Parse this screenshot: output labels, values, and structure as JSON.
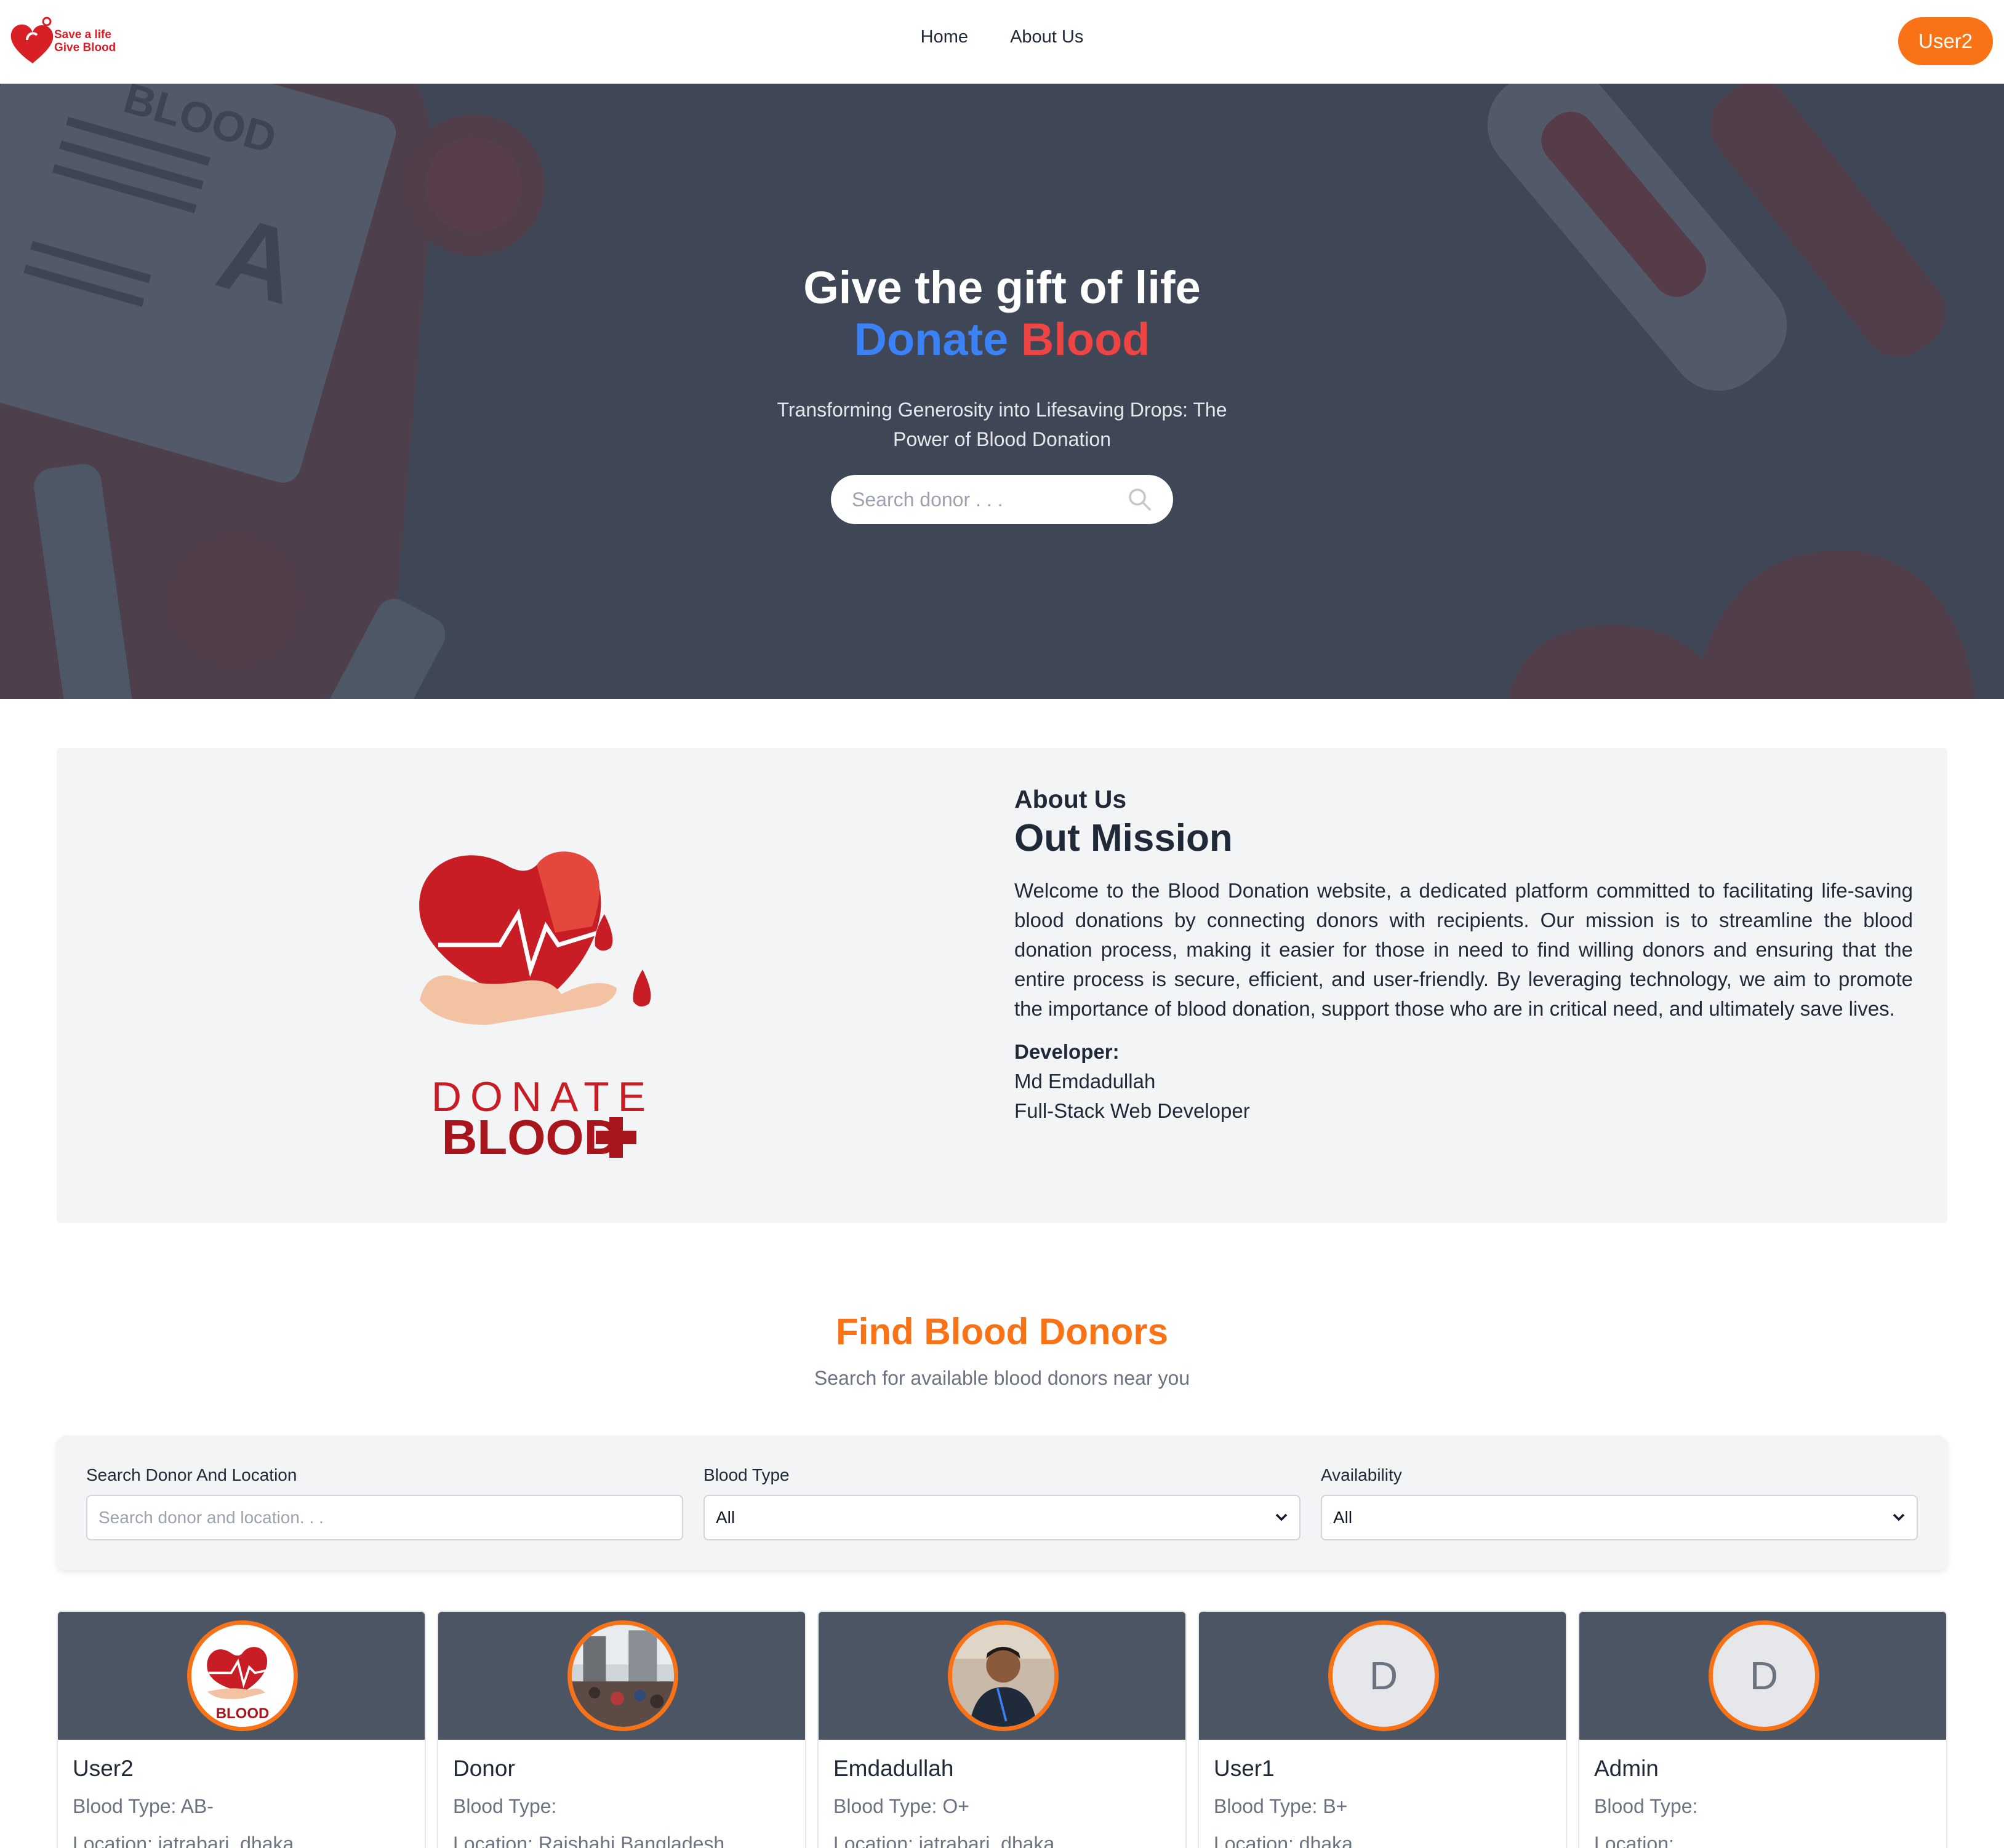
{
  "navbar": {
    "logo_line1": "Save a life",
    "logo_line2": "Give Blood",
    "links": [
      "Home",
      "About Us"
    ],
    "user_button": "User2"
  },
  "hero": {
    "title": "Give the gift of life",
    "title_blue": "Donate",
    "title_red": "Blood",
    "subtitle": "Transforming Generosity into Lifesaving Drops: The Power of Blood Donation",
    "search_placeholder": "Search donor . . ."
  },
  "about": {
    "logo_word1": "DONATE",
    "logo_word2": "BLOOD",
    "eyebrow": "About Us",
    "title": "Out Mission",
    "paragraph": "Welcome to the Blood Donation website, a dedicated platform committed to facilitating life-saving blood donations by connecting donors with recipients. Our mission is to streamline the blood donation process, making it easier for those in need to find willing donors and ensuring that the entire process is secure, efficient, and user-friendly. By leveraging technology, we aim to promote the importance of blood donation, support those who are in critical need, and ultimately save lives.",
    "developer_label": "Developer:",
    "developer_name": "Md Emdadullah",
    "developer_role": "Full-Stack Web Developer"
  },
  "find": {
    "title": "Find Blood Donors",
    "subtitle": "Search for available blood donors near you"
  },
  "filters": {
    "search_label": "Search Donor And Location",
    "search_placeholder": "Search donor and location. . .",
    "blood_type_label": "Blood Type",
    "blood_type_value": "All",
    "availability_label": "Availability",
    "availability_value": "All"
  },
  "donors": [
    {
      "name": "User2",
      "blood": "Blood Type: AB-",
      "location": "Location: jatrabari, dhaka",
      "avatar": "logo-image"
    },
    {
      "name": "Donor",
      "blood": "Blood Type:",
      "location": "Location: Rajshahi,Bangladesh",
      "avatar": "street-photo"
    },
    {
      "name": "Emdadullah",
      "blood": "Blood Type: O+",
      "location": "Location: jatrabari, dhaka",
      "avatar": "person-photo"
    },
    {
      "name": "User1",
      "blood": "Blood Type: B+",
      "location": "Location: dhaka",
      "avatar": "D"
    },
    {
      "name": "Admin",
      "blood": "Blood Type:",
      "location": "Location:",
      "avatar": "D"
    }
  ],
  "colors": {
    "accent": "#f97316",
    "hero_bg": "#3f4756",
    "title_blue": "#3b82f6",
    "title_red": "#ef4444",
    "card_header": "#4b5563"
  }
}
